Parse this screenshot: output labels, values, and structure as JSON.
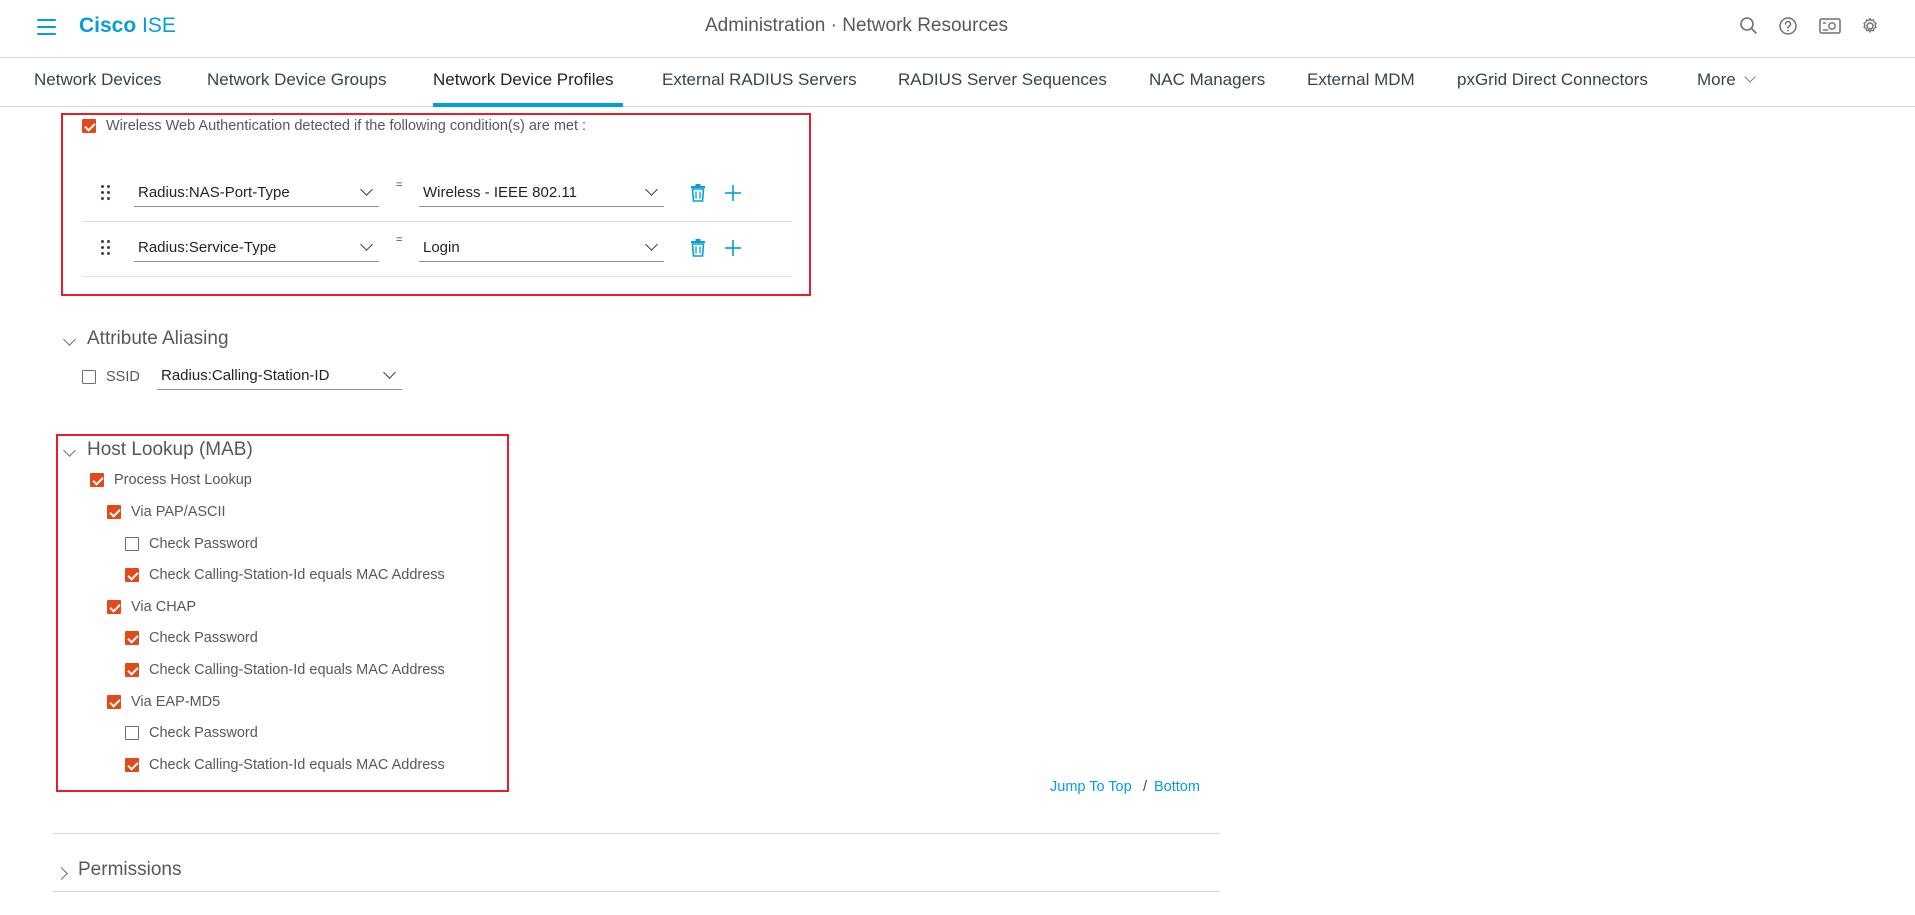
{
  "header": {
    "brand_bold": "Cisco",
    "brand_light": "ISE",
    "title": "Administration · Network Resources",
    "icons": [
      "search-icon",
      "help-icon",
      "dashboard-icon",
      "settings-icon"
    ]
  },
  "tabs": [
    {
      "label": "Network Devices",
      "active": false
    },
    {
      "label": "Network Device Groups",
      "active": false
    },
    {
      "label": "Network Device Profiles",
      "active": true
    },
    {
      "label": "External RADIUS Servers",
      "active": false
    },
    {
      "label": "RADIUS Server Sequences",
      "active": false
    },
    {
      "label": "NAC Managers",
      "active": false
    },
    {
      "label": "External MDM",
      "active": false
    },
    {
      "label": "pxGrid Direct Connectors",
      "active": false
    },
    {
      "label": "More",
      "active": false
    }
  ],
  "wireless": {
    "checked": true,
    "label": "Wireless Web Authentication detected if the following condition(s) are met :",
    "conditions": [
      {
        "attribute": "Radius:NAS-Port-Type",
        "operator": "=",
        "value": "Wireless - IEEE 802.11"
      },
      {
        "attribute": "Radius:Service-Type",
        "operator": "=",
        "value": "Login"
      }
    ]
  },
  "aliasing": {
    "title": "Attribute Aliasing",
    "ssid_checked": false,
    "ssid_label": "SSID",
    "ssid_value": "Radius:Calling-Station-ID"
  },
  "host_lookup": {
    "title": "Host Lookup (MAB)",
    "process": {
      "label": "Process Host Lookup",
      "checked": true
    },
    "via_pap": {
      "label": "Via PAP/ASCII",
      "checked": true
    },
    "pap_check_password": {
      "label": "Check Password",
      "checked": false
    },
    "pap_check_calling": {
      "label": "Check Calling-Station-Id equals MAC Address",
      "checked": true
    },
    "via_chap": {
      "label": "Via CHAP",
      "checked": true
    },
    "chap_check_password": {
      "label": "Check Password",
      "checked": true
    },
    "chap_check_calling": {
      "label": "Check Calling-Station-Id equals MAC Address",
      "checked": true
    },
    "via_eap": {
      "label": "Via EAP-MD5",
      "checked": true
    },
    "eap_check_password": {
      "label": "Check Password",
      "checked": false
    },
    "eap_check_calling": {
      "label": "Check Calling-Station-Id equals MAC Address",
      "checked": true
    }
  },
  "jump": {
    "top_label": "Jump To Top",
    "separator": "/",
    "bottom_label": "Bottom"
  },
  "permissions": {
    "title": "Permissions"
  },
  "colors": {
    "accent": "#049fd9",
    "checkbox": "#e34a1b",
    "highlight": "#e5202e"
  }
}
